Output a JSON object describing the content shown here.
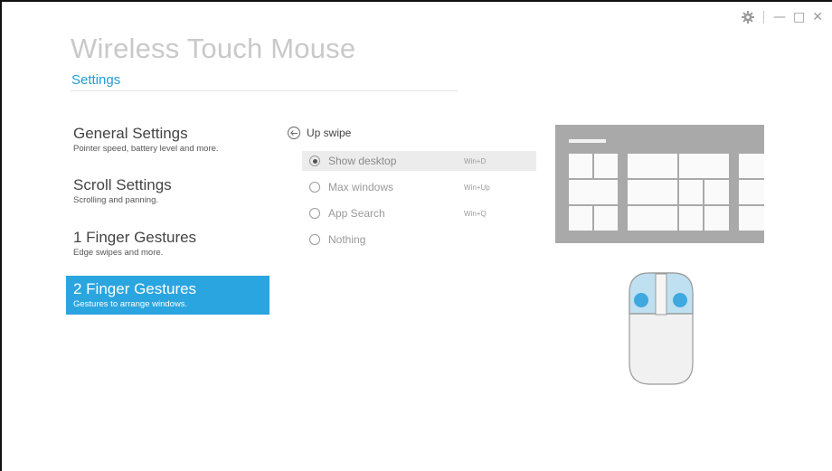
{
  "window": {
    "title": "Wireless Touch Mouse",
    "controls": {
      "settings_icon": "gear-icon",
      "minimize": "—",
      "maximize": "□",
      "close": "✕"
    }
  },
  "tabs": [
    {
      "label": "Settings",
      "active": true
    }
  ],
  "nav": [
    {
      "title": "General Settings",
      "subtitle": "Pointer speed, battery level and more.",
      "active": false
    },
    {
      "title": "Scroll Settings",
      "subtitle": "Scrolling and panning.",
      "active": false
    },
    {
      "title": "1 Finger Gestures",
      "subtitle": "Edge swipes and more.",
      "active": false
    },
    {
      "title": "2 Finger Gestures",
      "subtitle": "Gestures to arrange windows.",
      "active": true
    }
  ],
  "gesture": {
    "back_icon": "back-arrow-circle-icon",
    "label": "Up swipe",
    "options": [
      {
        "label": "Show desktop",
        "shortcut": "Win+D",
        "selected": true
      },
      {
        "label": "Max windows",
        "shortcut": "Win+Up",
        "selected": false
      },
      {
        "label": "App Search",
        "shortcut": "Win+Q",
        "selected": false
      },
      {
        "label": "Nothing",
        "shortcut": "",
        "selected": false
      }
    ]
  },
  "colors": {
    "accent": "#2aa5e0",
    "link": "#1e9fd6",
    "title_gray": "#c9c9c9",
    "screen_gray": "#a9a9a9",
    "touch_zone": "#bfe0f1",
    "finger_dot": "#3ea8df"
  },
  "illustration": {
    "screen_icon": "desktop-tiles-illustration",
    "mouse_icon": "mouse-two-finger-illustration"
  }
}
